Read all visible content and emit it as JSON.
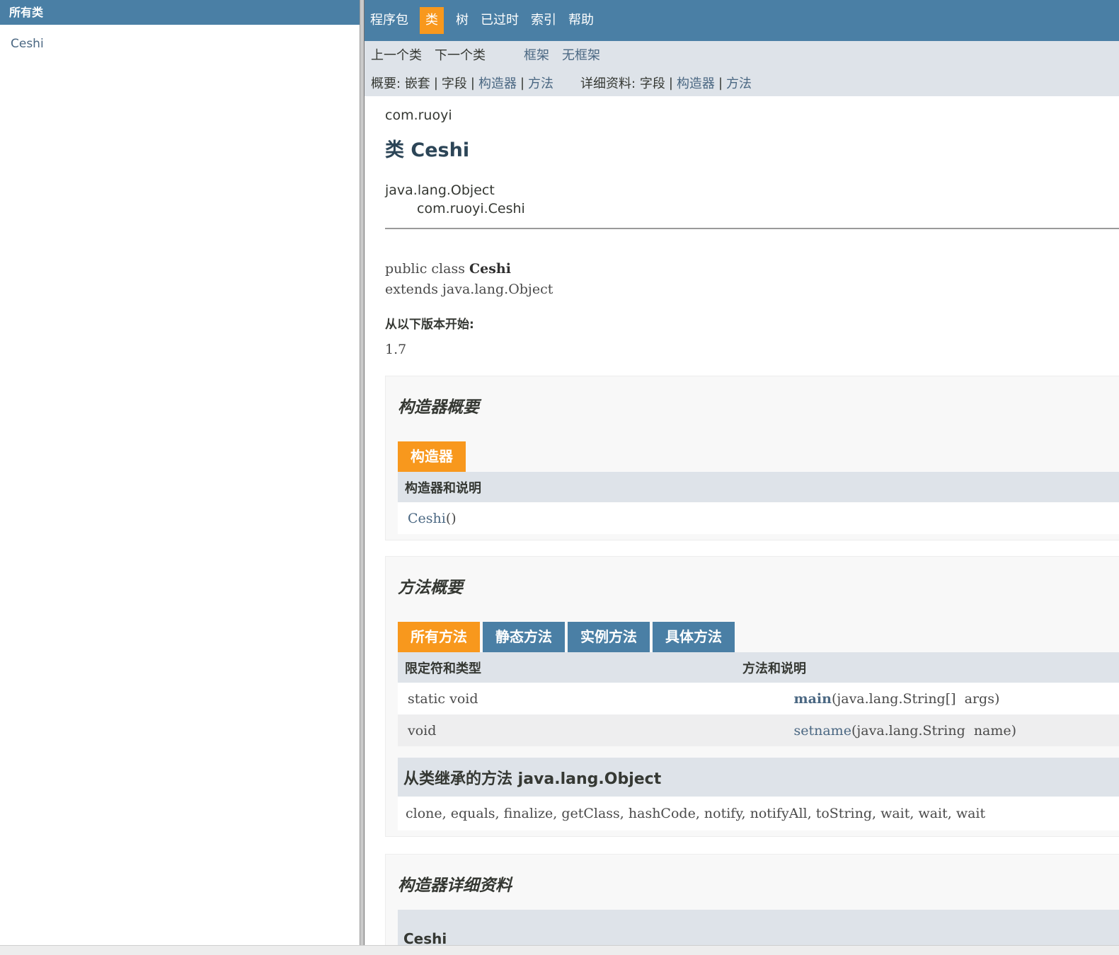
{
  "left_frame": {
    "header": "所有类",
    "classes": [
      "Ceshi"
    ]
  },
  "top_nav": {
    "items": [
      "程序包",
      "类",
      "树",
      "已过时",
      "索引",
      "帮助"
    ],
    "active": "类"
  },
  "subnav": {
    "prev": "上一个类",
    "next": "下一个类",
    "frames": "框架",
    "no_frames": "无框架",
    "summary_label": "概要:",
    "summary_nested": "嵌套",
    "summary_field": "字段",
    "summary_constructor": "构造器",
    "summary_method": "方法",
    "detail_label": "详细资料:",
    "detail_field": "字段",
    "detail_constructor": "构造器",
    "detail_method": "方法",
    "separator": "|"
  },
  "content": {
    "package": "com.ruoyi",
    "title": "类 Ceshi",
    "inheritance": [
      "java.lang.Object",
      "com.ruoyi.Ceshi"
    ],
    "decl_prefix": "public class ",
    "decl_name": "Ceshi",
    "decl_extends": "extends java.lang.Object",
    "since_label": "从以下版本开始:",
    "since_value": "1.7"
  },
  "constructor_summary": {
    "title": "构造器概要",
    "tab": "构造器",
    "header": "构造器和说明",
    "rows": [
      {
        "name": "Ceshi",
        "params": "()"
      }
    ]
  },
  "method_summary": {
    "title": "方法概要",
    "tabs": [
      "所有方法",
      "静态方法",
      "实例方法",
      "具体方法"
    ],
    "header_modifier": "限定符和类型",
    "header_method": "方法和说明",
    "rows": [
      {
        "modifier": "static void",
        "name": "main",
        "params": "(java.lang.String[]  args)"
      },
      {
        "modifier": "void",
        "name": "setname",
        "params": "(java.lang.String  name)"
      }
    ],
    "inherited_title": "从类继承的方法 java.lang.Object",
    "inherited_methods": "clone, equals, finalize, getClass, hashCode, notify, notifyAll, toString, wait, wait, wait"
  },
  "constructor_detail": {
    "title": "构造器详细资料",
    "item": "Ceshi"
  },
  "colors": {
    "nav_blue": "#4a7fa5",
    "active_orange": "#f8981d",
    "subnav_bg": "#dee3e9",
    "link": "#4a6782"
  }
}
